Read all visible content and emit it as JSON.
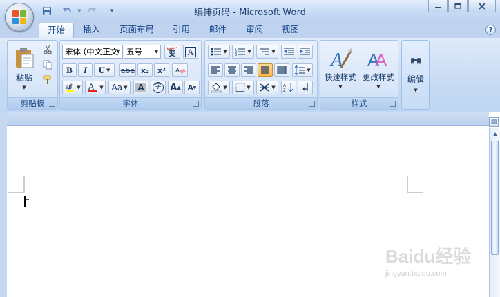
{
  "window": {
    "title": "编排页码 - Microsoft Word"
  },
  "quick_access": {
    "icons": [
      "save-icon",
      "undo-icon",
      "redo-icon",
      "customize-icon"
    ]
  },
  "tabs": [
    {
      "label": "开始",
      "active": true
    },
    {
      "label": "插入",
      "active": false
    },
    {
      "label": "页面布局",
      "active": false
    },
    {
      "label": "引用",
      "active": false
    },
    {
      "label": "邮件",
      "active": false
    },
    {
      "label": "审阅",
      "active": false
    },
    {
      "label": "视图",
      "active": false
    }
  ],
  "help": {
    "glyph": "?"
  },
  "clipboard": {
    "label": "剪贴板",
    "paste_label": "粘贴"
  },
  "font": {
    "label": "字体",
    "font_name": "宋体 (中文正文",
    "font_size": "五号",
    "grow_label": "A",
    "shrink_label": "A",
    "bold": "B",
    "italic": "I",
    "underline": "U",
    "strike": "abe",
    "subscript": "x₂",
    "superscript": "x²",
    "change_case": "Aa",
    "char_shading": "A",
    "enclose_char": "字",
    "wen_label": "wén",
    "wen_char": "变",
    "border_char": "A"
  },
  "paragraph": {
    "label": "段落"
  },
  "styles": {
    "label": "样式",
    "quick_styles": "快速样式",
    "change_styles": "更改样式"
  },
  "editing": {
    "label": "编辑"
  },
  "watermark": {
    "brand": "Baidu经验",
    "url": "jingyan.baidu.com"
  },
  "colors": {
    "highlight": "#ffff00",
    "font_color": "#e2231a",
    "accent": "#15428b"
  }
}
